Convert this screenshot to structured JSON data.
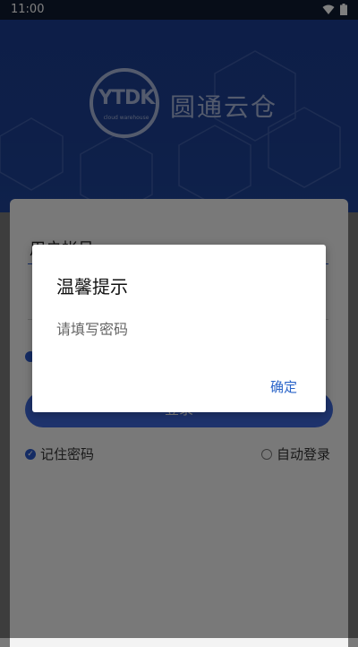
{
  "status_bar": {
    "time": "11:00"
  },
  "header": {
    "logo_text": "YTDK",
    "logo_sub": "cloud warehouse",
    "brand_name": "圆通云仓"
  },
  "login": {
    "account_placeholder": "用户帐号",
    "login_button": "登录",
    "remember_password": "记住密码",
    "auto_login": "自动登录"
  },
  "dialog": {
    "title": "温馨提示",
    "message": "请填写密码",
    "confirm": "确定"
  },
  "colors": {
    "primary": "#2a58c9",
    "header_bg": "#1c3f92",
    "dialog_button": "#2a64c9"
  }
}
